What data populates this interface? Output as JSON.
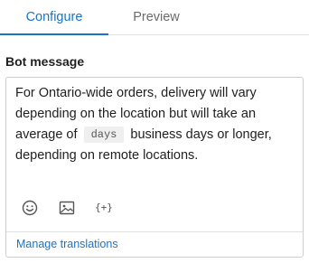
{
  "tabs": [
    {
      "label": "Configure",
      "active": true
    },
    {
      "label": "Preview",
      "active": false
    }
  ],
  "section": {
    "label": "Bot message"
  },
  "message": {
    "text_before": "For Ontario-wide orders, delivery will vary depending on the location but will take an average of",
    "variable_chip": "days",
    "text_after": "business days or longer, depending on remote locations."
  },
  "toolbar": {
    "icons": [
      "emoji-icon",
      "image-icon",
      "variable-icon"
    ],
    "variable_glyph": "{+}"
  },
  "footer": {
    "link_label": "Manage translations"
  },
  "colors": {
    "accent": "#1a73c7",
    "border": "#cfcfcf",
    "chip_bg": "#efefef"
  }
}
